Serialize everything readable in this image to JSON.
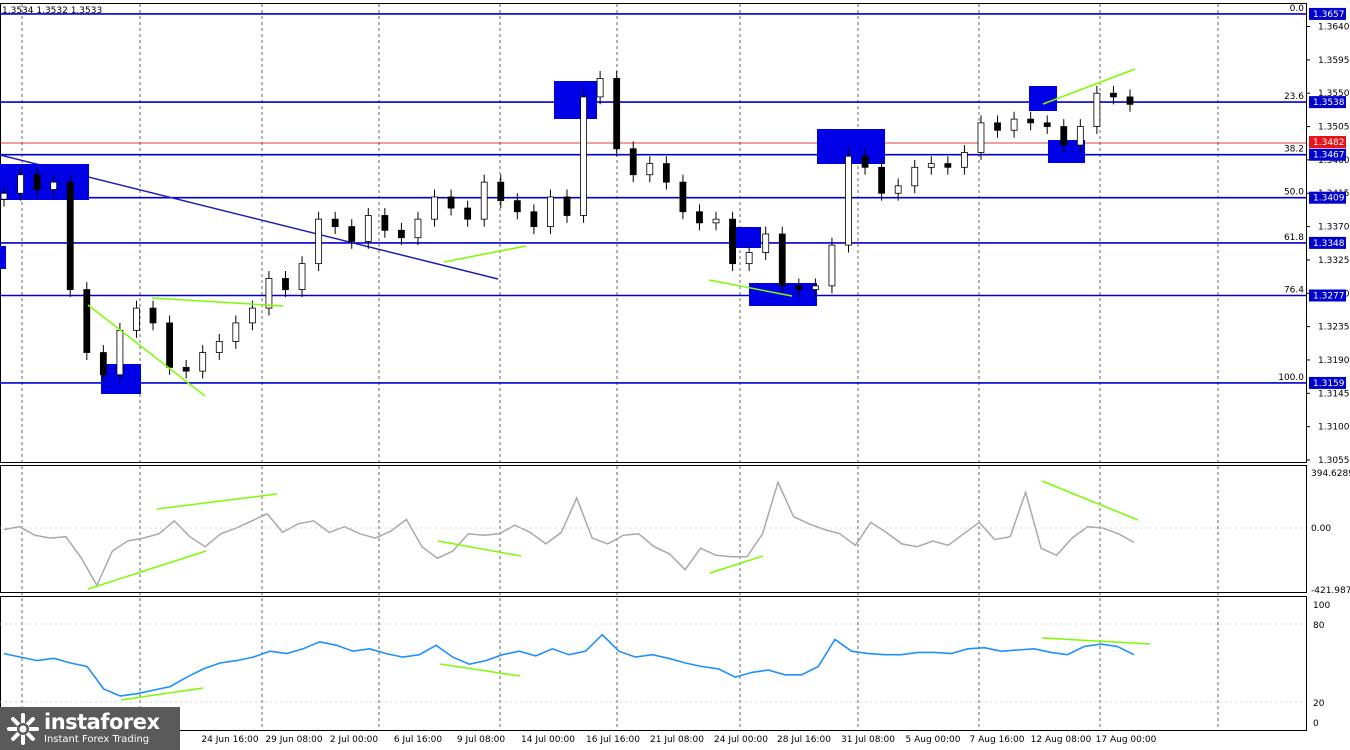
{
  "ohlc_text": "1.3534 1.3532 1.3533",
  "price_axis": [
    "1.3640",
    "1.3595",
    "1.3550",
    "1.3505",
    "1.3460",
    "1.3415",
    "1.3370",
    "1.3325",
    "1.3280",
    "1.3235",
    "1.3190",
    "1.3145",
    "1.3100",
    "1.3055"
  ],
  "time_axis": [
    "24 Jun 16:00",
    "29 Jun 08:00",
    "2 Jul 00:00",
    "6 Jul 16:00",
    "9 Jul 08:00",
    "14 Jul 00:00",
    "16 Jul 16:00",
    "21 Jul 08:00",
    "24 Jul 00:00",
    "28 Jul 16:00",
    "31 Jul 08:00",
    "5 Aug 00:00",
    "7 Aug 16:00",
    "12 Aug 08:00",
    "17 Aug 00:00"
  ],
  "fib_levels": [
    {
      "ratio": "0.0",
      "price": "1.3657"
    },
    {
      "ratio": "23.6",
      "price": "1.3538"
    },
    {
      "ratio": "38.2",
      "price": "1.3467"
    },
    {
      "ratio": "50.0",
      "price": "1.3409"
    },
    {
      "ratio": "61.8",
      "price": "1.3348"
    },
    {
      "ratio": "76.4",
      "price": "1.3277"
    },
    {
      "ratio": "100.0",
      "price": "1.3159"
    }
  ],
  "current_price_label": "1.3482",
  "cci_axis": {
    "top": "394.6289",
    "mid": "0.00",
    "bottom": "-421.9874"
  },
  "rsi_axis": [
    "100",
    "80",
    "20",
    "0"
  ],
  "colors": {
    "candle": "#000000",
    "fib": "#0000cd",
    "trend": "#1e1eb4",
    "divergence": "#7cfc00",
    "cci": "#a9a9a9",
    "rsi": "#1e90ff",
    "price_line": "#cc0000"
  },
  "chart_data": {
    "type": "candlestick",
    "ylim": [
      1.3055,
      1.3665
    ],
    "main_series": [
      1.3415,
      1.344,
      1.342,
      1.343,
      1.3285,
      1.32,
      1.317,
      1.323,
      1.326,
      1.324,
      1.318,
      1.3175,
      1.32,
      1.3215,
      1.324,
      1.326,
      1.33,
      1.3285,
      1.332,
      1.338,
      1.337,
      1.335,
      1.3385,
      1.3365,
      1.3355,
      1.338,
      1.341,
      1.3395,
      1.338,
      1.343,
      1.3405,
      1.339,
      1.337,
      1.341,
      1.3385,
      1.3545,
      1.357,
      1.3475,
      1.344,
      1.3455,
      1.343,
      1.339,
      1.3375,
      1.338,
      1.332,
      1.3335,
      1.336,
      1.329,
      1.3285,
      1.329,
      1.3345,
      1.3465,
      1.345,
      1.3415,
      1.3425,
      1.345,
      1.3455,
      1.345,
      1.347,
      1.351,
      1.35,
      1.3515,
      1.351,
      1.3505,
      1.348,
      1.3505,
      1.355,
      1.3545,
      1.3535
    ],
    "cci_series": [
      0,
      20,
      -40,
      -60,
      -50,
      -200,
      -390,
      -150,
      -80,
      -60,
      -30,
      60,
      -50,
      -120,
      -30,
      10,
      60,
      110,
      -20,
      40,
      60,
      -20,
      20,
      -30,
      -60,
      -10,
      70,
      -120,
      -200,
      -150,
      -30,
      -40,
      -30,
      30,
      -20,
      -100,
      -20,
      220,
      -60,
      -100,
      -40,
      -30,
      -120,
      -170,
      -280,
      -130,
      -180,
      -190,
      -190,
      -30,
      330,
      90,
      40,
      0,
      -30,
      -110,
      50,
      -20,
      -100,
      -120,
      -80,
      -110,
      -30,
      50,
      -70,
      -50,
      260,
      -130,
      -180,
      -60,
      20,
      10,
      -30,
      -90
    ],
    "rsi_series": [
      58,
      55,
      52,
      54,
      50,
      47,
      28,
      22,
      24,
      27,
      30,
      38,
      45,
      50,
      52,
      55,
      60,
      58,
      62,
      68,
      65,
      60,
      62,
      58,
      55,
      57,
      65,
      55,
      49,
      52,
      57,
      60,
      56,
      62,
      57,
      60,
      74,
      60,
      55,
      57,
      54,
      50,
      47,
      45,
      38,
      42,
      44,
      40,
      40,
      47,
      70,
      60,
      58,
      57,
      57,
      59,
      59,
      58,
      62,
      63,
      60,
      61,
      62,
      59,
      57,
      64,
      66,
      64,
      57
    ]
  }
}
